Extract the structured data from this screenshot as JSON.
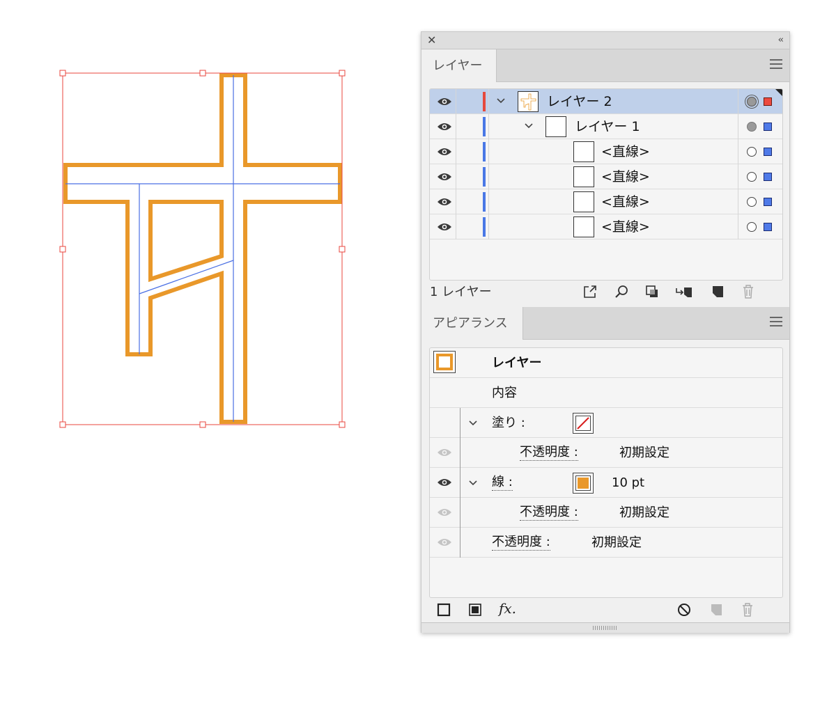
{
  "canvas": {
    "stroke_color": "#e9982a",
    "path_color": "#4a6fe3",
    "bbox_color": "#e9453d"
  },
  "panel": {
    "close_glyph": "✕",
    "collapse_glyph": "‹‹",
    "layers": {
      "tab_label": "レイヤー",
      "rows": [
        {
          "name": "レイヤー 2",
          "color": "#e64a3c",
          "selected": true,
          "sel_square_color": "#ec4a3f"
        },
        {
          "name": "レイヤー 1",
          "color": "#4a78e6",
          "selected": false,
          "sel_square_color": "#4f7ae8"
        },
        {
          "name": "<直線>",
          "color": "#4a78e6",
          "selected": false,
          "sel_square_color": "#4f7ae8"
        },
        {
          "name": "<直線>",
          "color": "#4a78e6",
          "selected": false,
          "sel_square_color": "#4f7ae8"
        },
        {
          "name": "<直線>",
          "color": "#4a78e6",
          "selected": false,
          "sel_square_color": "#4f7ae8"
        },
        {
          "name": "<直線>",
          "color": "#4a78e6",
          "selected": false,
          "sel_square_color": "#4f7ae8"
        }
      ],
      "count_label": "1 レイヤー",
      "footer_icons": [
        "export-icon",
        "search-icon",
        "clipping-mask-icon",
        "move-to-layer-icon",
        "new-layer-icon",
        "trash-icon"
      ]
    },
    "appearance": {
      "tab_label": "アピアランス",
      "header_label": "レイヤー",
      "contents_label": "内容",
      "fill_label": "塗り :",
      "fill_opacity_label": "不透明度 :",
      "fill_opacity_value": "初期設定",
      "stroke_label": "線 :",
      "stroke_weight": "10 pt",
      "stroke_color": "#e9982a",
      "stroke_opacity_label": "不透明度 :",
      "stroke_opacity_value": "初期設定",
      "opacity_label": "不透明度 :",
      "opacity_value": "初期設定",
      "fx_label": "fx.",
      "footer_icons": [
        "add-stroke-icon",
        "add-fill-icon",
        "fx-icon",
        "clear-appearance-icon",
        "duplicate-item-icon",
        "trash-icon"
      ]
    }
  }
}
